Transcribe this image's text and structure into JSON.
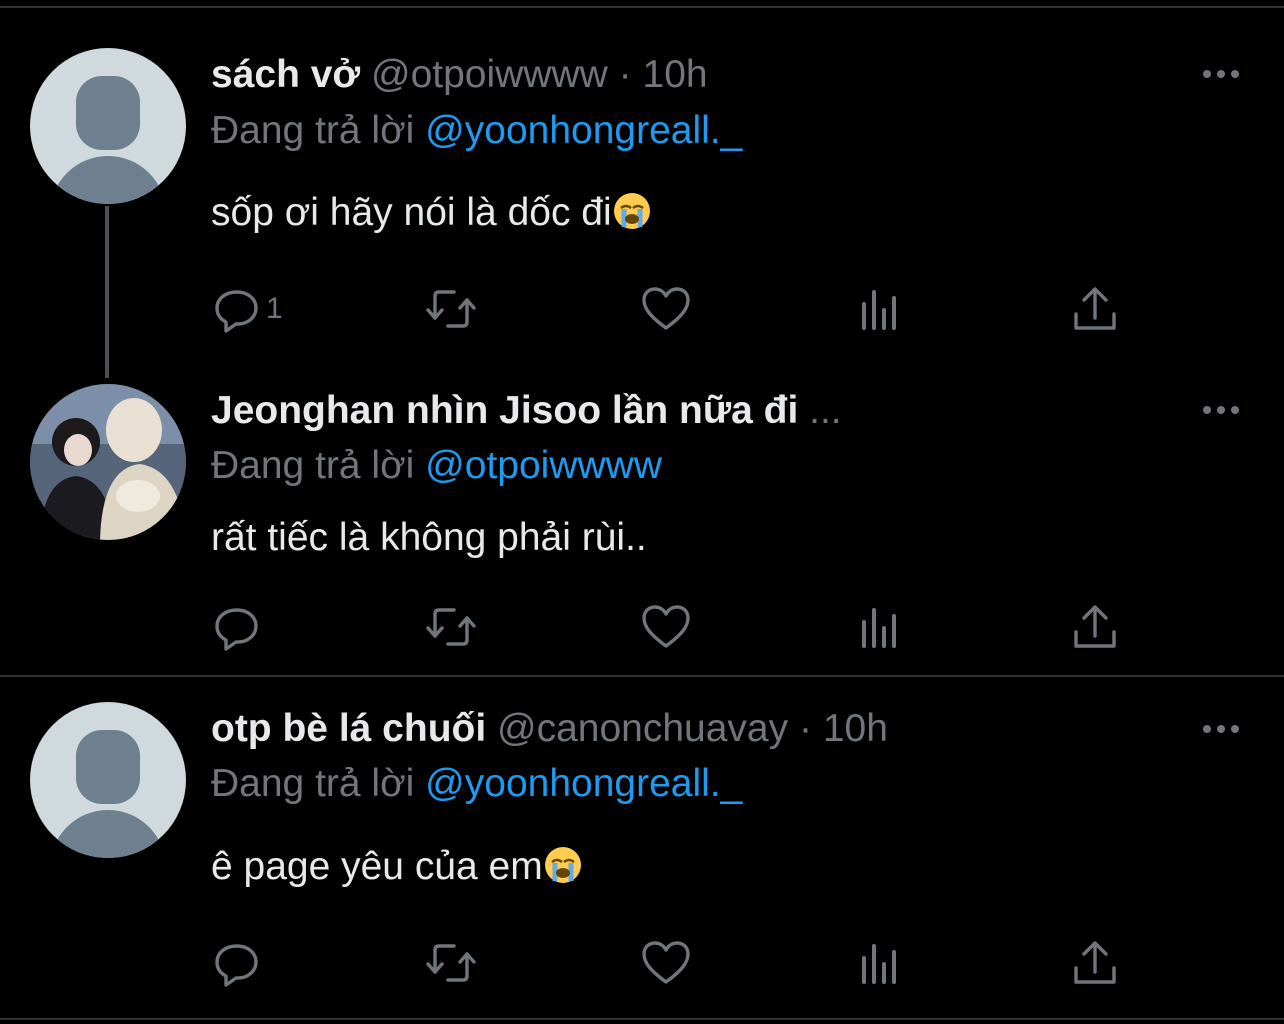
{
  "tweets": [
    {
      "name": "sách vở",
      "handle": "@otpoiwwww",
      "separator": "·",
      "time": "10h",
      "reply_prefix": "Đang trả lời",
      "reply_to": "@yoonhongreall._",
      "text": "sốp ơi hãy nói là dốc đi",
      "emoji": "loudly-crying-face",
      "reply_count": "1",
      "avatar": "default-avatar"
    },
    {
      "name": "Jeonghan nhìn Jisoo lần nữa đi",
      "name_truncation": "...",
      "reply_prefix": "Đang trả lời",
      "reply_to": "@otpoiwwww",
      "text": "rất tiếc là không phải rùi..",
      "reply_count": "",
      "avatar": "photo-avatar"
    },
    {
      "name": "otp bè lá chuối",
      "handle": "@canonchuavay",
      "separator": "·",
      "time": "10h",
      "reply_prefix": "Đang trả lời",
      "reply_to": "@yoonhongreall._",
      "text": "ê page yêu của em",
      "emoji": "loudly-crying-face",
      "reply_count": "",
      "avatar": "default-avatar"
    }
  ],
  "icons": {
    "reply": "reply-icon",
    "retweet": "retweet-icon",
    "like": "heart-icon",
    "views": "views-icon",
    "share": "share-icon",
    "more": "more-icon"
  },
  "colors": {
    "background": "#000000",
    "text": "#e7e9ea",
    "secondary": "#71767b",
    "link": "#1d9bf0",
    "divider": "#2f3336"
  }
}
